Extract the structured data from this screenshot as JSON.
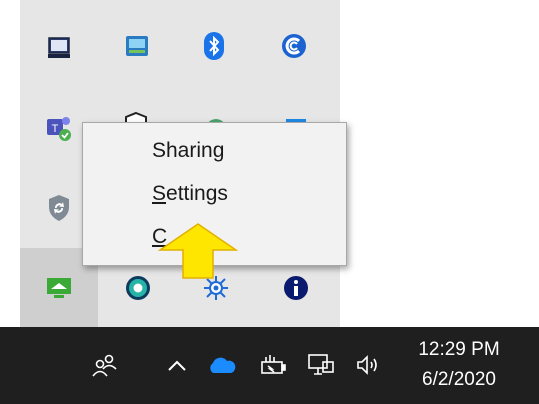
{
  "context_menu": {
    "items": [
      {
        "label": "Sharing",
        "accel": "",
        "rest": "Sharing"
      },
      {
        "label": "Settings",
        "accel": "S",
        "rest": "ettings"
      },
      {
        "label": "Close",
        "accel": "C",
        "rest": ""
      }
    ]
  },
  "taskbar": {
    "time": "12:29 PM",
    "date": "6/2/2020"
  },
  "colors": {
    "flyout_bg": "#e6e6e6",
    "taskbar_bg": "#1f1f1f",
    "accent_blue": "#1a73e8",
    "arrow_yellow": "#ffe600"
  },
  "icons": [
    "monitor-icon",
    "network-card-icon",
    "bluetooth-icon",
    "ccleaner-icon",
    "teams-icon",
    "shield-icon",
    "green-app-icon",
    "blue-app-icon",
    "security-shield-icon",
    "remote-desktop-icon",
    "teal-circle-icon",
    "network-hub-icon",
    "info-icon",
    "people-icon",
    "chevron-up-icon",
    "onedrive-icon",
    "battery-icon",
    "network-icon",
    "volume-icon"
  ]
}
